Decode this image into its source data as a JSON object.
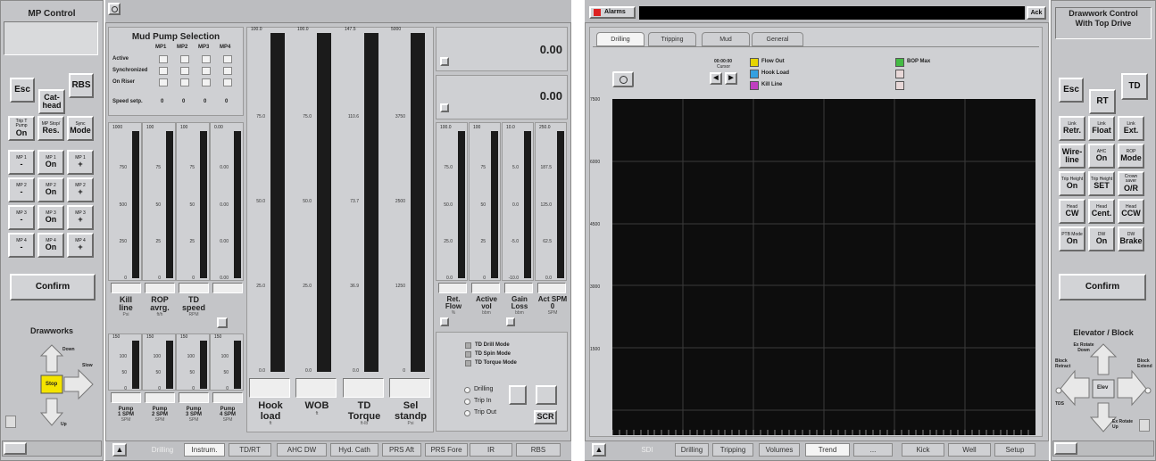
{
  "left_panel": {
    "title": "MP Control",
    "esc": "Esc",
    "rbs": "RBS",
    "cathead": [
      "Cat-",
      "head"
    ],
    "row1": [
      {
        "s": "Trip T Pump",
        "m": "On"
      },
      {
        "s": "MP Stop/",
        "m": "Res."
      },
      {
        "s": "Sync",
        "m": "Mode"
      }
    ],
    "mp_rows": [
      [
        {
          "s": "MP 1",
          "m": "-"
        },
        {
          "s": "MP 1",
          "m": "On"
        },
        {
          "s": "MP 1",
          "m": "+"
        }
      ],
      [
        {
          "s": "MP 2",
          "m": "-"
        },
        {
          "s": "MP 2",
          "m": "On"
        },
        {
          "s": "MP 2",
          "m": "+"
        }
      ],
      [
        {
          "s": "MP 3",
          "m": "-"
        },
        {
          "s": "MP 3",
          "m": "On"
        },
        {
          "s": "MP 3",
          "m": "+"
        }
      ],
      [
        {
          "s": "MP 4",
          "m": "-"
        },
        {
          "s": "MP 4",
          "m": "On"
        },
        {
          "s": "MP 4",
          "m": "+"
        }
      ]
    ],
    "confirm": "Confirm",
    "drawworks": "Drawworks",
    "down": "Down",
    "slow": "Slow",
    "stop": "Stop",
    "up": "Up"
  },
  "mud_pump": {
    "title": "Mud Pump Selection",
    "cols": [
      "MP1",
      "MP2",
      "MP3",
      "MP4"
    ],
    "rows": [
      "Active",
      "Synchronized",
      "On Riser"
    ],
    "speed_label": "Speed setp.",
    "speed_vals": [
      "0",
      "0",
      "0",
      "0"
    ]
  },
  "small_gauges": [
    {
      "max": "1000",
      "ticks": [
        "750",
        "500",
        "250",
        "0"
      ]
    },
    {
      "max": "100",
      "ticks": [
        "75",
        "50",
        "25",
        "0"
      ]
    },
    {
      "max": "100",
      "ticks": [
        "75",
        "50",
        "25",
        "0"
      ]
    },
    {
      "max": "0.00",
      "ticks": [
        "0.00",
        "0.00",
        "0.00",
        "0.00"
      ]
    }
  ],
  "small_labels": [
    {
      "t": [
        "Kill",
        "line"
      ],
      "u": "Psi"
    },
    {
      "t": [
        "ROP",
        "avrg."
      ],
      "u": "ft/h"
    },
    {
      "t": [
        "TD",
        "speed"
      ],
      "u": "RPM"
    }
  ],
  "pump_gauges": [
    {
      "max": "150",
      "ticks": [
        "100",
        "50",
        "0"
      ]
    },
    {
      "max": "150",
      "ticks": [
        "100",
        "50",
        "0"
      ]
    },
    {
      "max": "150",
      "ticks": [
        "100",
        "50",
        "0"
      ]
    },
    {
      "max": "150",
      "ticks": [
        "100",
        "50",
        "0"
      ]
    }
  ],
  "pump_labels": [
    {
      "t": [
        "Pump",
        "1 SPM"
      ],
      "u": "SPM"
    },
    {
      "t": [
        "Pump",
        "2 SPM"
      ],
      "u": "SPM"
    },
    {
      "t": [
        "Pump",
        "3 SPM"
      ],
      "u": "SPM"
    },
    {
      "t": [
        "Pump",
        "4 SPM"
      ],
      "u": "SPM"
    }
  ],
  "big_gauges": [
    {
      "max": "100.0",
      "ticks": [
        "75.0",
        "50.0",
        "25.0",
        "0.0"
      ],
      "label": [
        "Hook",
        "load"
      ],
      "u": "ft"
    },
    {
      "max": "100.0",
      "ticks": [
        "75.0",
        "50.0",
        "25.0",
        "0.0"
      ],
      "label": [
        "WOB"
      ],
      "u": "ft"
    },
    {
      "max": "147.5",
      "ticks": [
        "110.6",
        "73.7",
        "36.9",
        "0.0"
      ],
      "label": [
        "TD Torque"
      ],
      "u": "ft-lb"
    },
    {
      "max": "5000",
      "ticks": [
        "3750",
        "2500",
        "1250",
        "0"
      ],
      "label": [
        "Sel",
        "standp"
      ],
      "u": "Psi"
    }
  ],
  "readouts": [
    "0.00",
    "0.00"
  ],
  "right_gauges": [
    {
      "max": "100.0",
      "ticks": [
        "75.0",
        "50.0",
        "25.0",
        "0.0"
      ]
    },
    {
      "max": "100",
      "ticks": [
        "75",
        "50",
        "25",
        "0"
      ]
    },
    {
      "max": "10.0",
      "ticks": [
        "5.0",
        "0.0",
        "-5.0",
        "-10.0"
      ]
    },
    {
      "max": "250.0",
      "ticks": [
        "187.5",
        "125.0",
        "62.5",
        "0.0"
      ]
    }
  ],
  "right_labels": [
    {
      "t": [
        "Ret.",
        "Flow"
      ],
      "u": "%"
    },
    {
      "t": [
        "Active",
        "vol"
      ],
      "u": "bbm"
    },
    {
      "t": [
        "Gain",
        "Loss"
      ],
      "u": "bbm"
    },
    {
      "t": [
        "Act SPM",
        "0"
      ],
      "u": "SPM"
    }
  ],
  "td_modes": [
    "TD Drill Mode",
    "TD Spin Mode",
    "TD Torque Mode"
  ],
  "radios": [
    "Drilling",
    "Trip In",
    "Trip Out"
  ],
  "scr": "SCR",
  "left_tabs": [
    "Drilling",
    "Instrum.",
    "TD/RT",
    "AHC DW",
    "Hyd. Cath",
    "PRS Aft",
    "PRS Fore",
    "IR",
    "RBS"
  ],
  "alarms": "Alarms",
  "ack": "Ack",
  "trend_tabs": [
    "Drilling",
    "Tripping",
    "Mud",
    "General"
  ],
  "cursor": {
    "time": "00:00:00",
    "label": "Cursor"
  },
  "legend": [
    {
      "name": "Flow Out",
      "color": "#e6d400"
    },
    {
      "name": "Hook Load",
      "color": "#33a0e0"
    },
    {
      "name": "Kill Line",
      "color": "#c040c0"
    }
  ],
  "legend2": [
    {
      "name": "BOP Max",
      "color": "#44bb44"
    }
  ],
  "yticks": [
    "7500",
    "6000",
    "4500",
    "3000",
    "1500"
  ],
  "bottom_tabs": [
    "SDI",
    "Drilling",
    "Tripping",
    "Volumes",
    "Trend",
    "...",
    "Kick",
    "Well",
    "Setup"
  ],
  "right_panel": {
    "title": [
      "Drawwork Control",
      "With Top Drive"
    ],
    "esc": "Esc",
    "rt": "RT",
    "td": "TD",
    "rows": [
      [
        {
          "s": "Link",
          "m": "Retr."
        },
        {
          "s": "Link",
          "m": "Float"
        },
        {
          "s": "Link",
          "m": "Ext."
        }
      ],
      [
        {
          "s": "",
          "m": "Wire-line"
        },
        {
          "s": "AHC",
          "m": "On"
        },
        {
          "s": "ROP",
          "m": "Mode"
        }
      ],
      [
        {
          "s": "Trip Height",
          "m": "On"
        },
        {
          "s": "Trip Height",
          "m": "SET"
        },
        {
          "s": "Crown saver",
          "m": "O/R"
        }
      ],
      [
        {
          "s": "Head",
          "m": "CW"
        },
        {
          "s": "Head",
          "m": "Cent."
        },
        {
          "s": "Head",
          "m": "CCW"
        }
      ],
      [
        {
          "s": "PTB Mode",
          "m": "On"
        },
        {
          "s": "DW",
          "m": "On"
        },
        {
          "s": "DW",
          "m": "Brake"
        }
      ]
    ],
    "confirm": "Confirm",
    "elevator": "Elevator / Block",
    "ex_rotate_down": "Ex Rotate Down",
    "block_retract": "Block Retract",
    "block_extend": "Block Extend",
    "elev": "Elev",
    "tds": "TDS",
    "ex_rotate_up": "Ex Rotate Up"
  }
}
